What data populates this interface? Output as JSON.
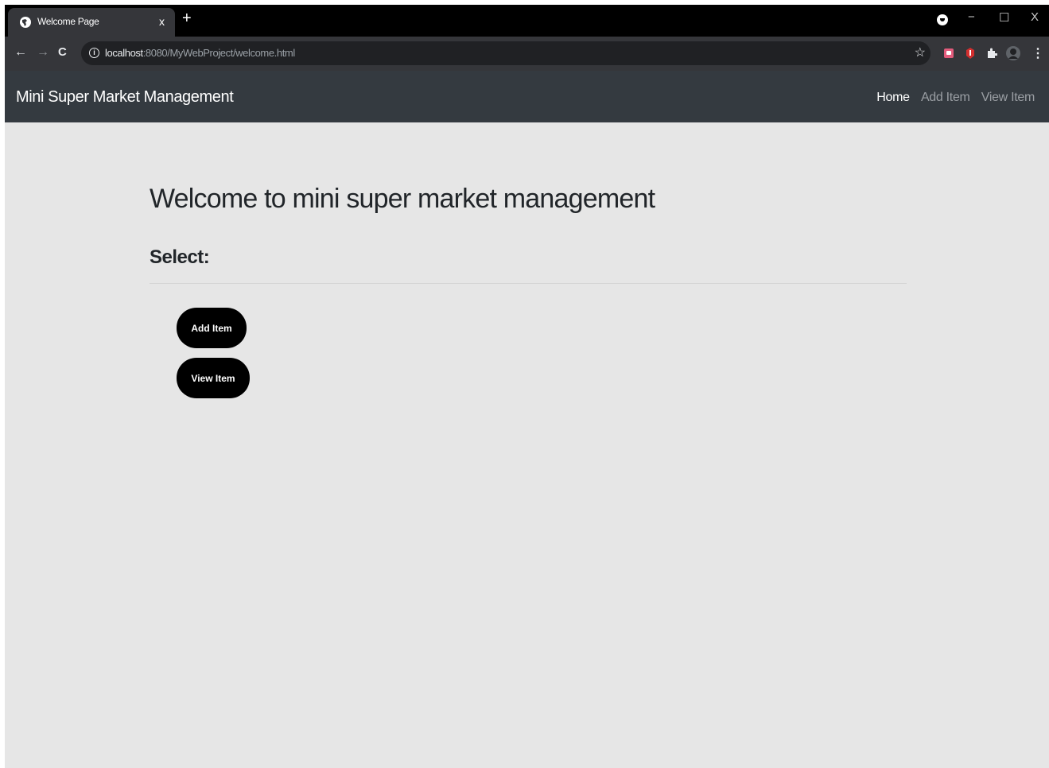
{
  "browser": {
    "tab_title": "Welcome Page",
    "tab_close": "x",
    "new_tab": "+",
    "url_host": "localhost",
    "url_rest": ":8080/MyWebProject/welcome.html",
    "controls": {
      "minimize": "−",
      "maximize": "☐",
      "close": "X"
    },
    "nav": {
      "back": "←",
      "forward": "→",
      "reload": "C"
    },
    "bookmark": "☆",
    "menu": "⋮"
  },
  "navbar": {
    "brand": "Mini Super Market Management",
    "links": [
      "Home",
      "Add Item",
      "View Item"
    ]
  },
  "main": {
    "heading": "Welcome to mini super market management",
    "subheading": "Select:",
    "buttons": [
      "Add Item",
      "View Item"
    ]
  }
}
